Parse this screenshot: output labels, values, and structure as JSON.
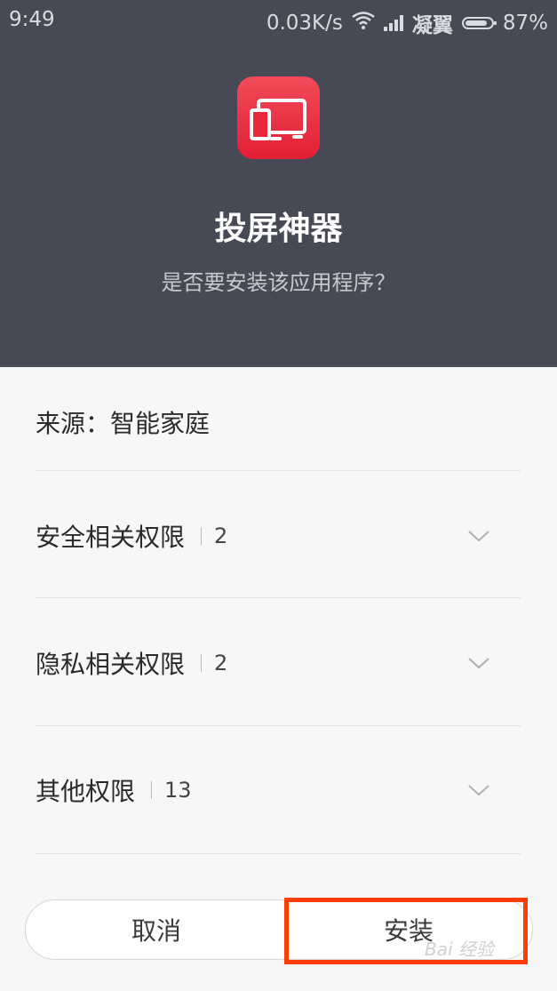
{
  "status_bar": {
    "time": "9:49",
    "speed": "0.03K/s",
    "carrier": "凝翼",
    "battery": "87%"
  },
  "app": {
    "name": "投屏神器",
    "question": "是否要安装该应用程序？",
    "icon": "screen-cast-icon",
    "accent_color": "#e8283b"
  },
  "source": {
    "label": "来源：智能家庭"
  },
  "permissions": [
    {
      "label": "安全相关权限",
      "count": "2"
    },
    {
      "label": "隐私相关权限",
      "count": "2"
    },
    {
      "label": "其他权限",
      "count": "13"
    }
  ],
  "buttons": {
    "cancel": "取消",
    "install": "安装"
  },
  "watermark": "Bai 经验",
  "colors": {
    "header_bg": "#474a54",
    "highlight": "#ff3c00"
  }
}
